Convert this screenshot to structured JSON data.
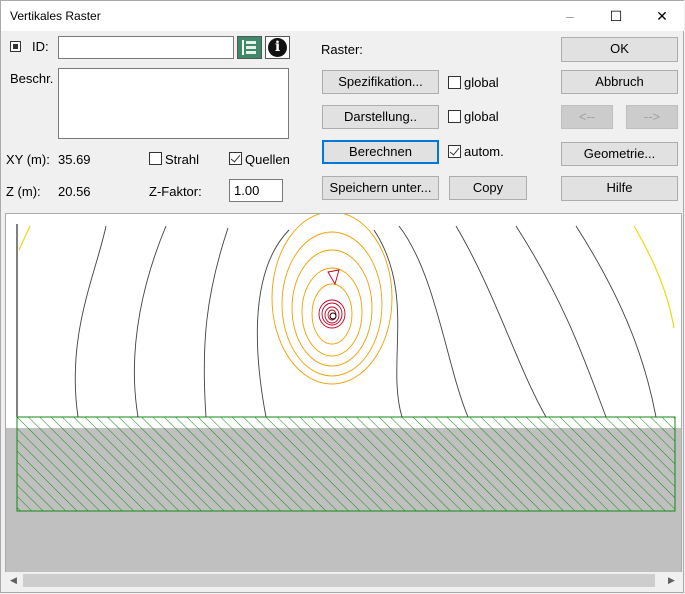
{
  "window": {
    "title": "Vertikales Raster",
    "minimize": "–",
    "maximize": "☐",
    "close": "✕"
  },
  "left": {
    "id_label": "ID:",
    "id_value": "",
    "beschr_label": "Beschr.",
    "beschr_value": "",
    "xy_label": "XY (m):",
    "xy_value": "35.69",
    "z_label": "Z (m):",
    "z_value": "20.56",
    "strahl_label": "Strahl",
    "strahl_checked": false,
    "quellen_label": "Quellen",
    "quellen_checked": true,
    "zfaktor_label": "Z-Faktor:",
    "zfaktor_value": "1.00"
  },
  "middle": {
    "raster_label": "Raster:",
    "spezifikation": "Spezifikation...",
    "darstellung": "Darstellung..",
    "berechnen": "Berechnen",
    "speichern": "Speichern unter...",
    "copy": "Copy",
    "global1_label": "global",
    "global1_checked": false,
    "global2_label": "global",
    "global2_checked": false,
    "autom_label": "autom.",
    "autom_checked": true
  },
  "right": {
    "ok": "OK",
    "abbruch": "Abbruch",
    "prev": "<--",
    "next": "-->",
    "geometrie": "Geometrie...",
    "hilfe": "Hilfe"
  },
  "colors": {
    "contour_gray": "#404040",
    "contour_orange": "#f0a000",
    "contour_red": "#c00020",
    "contour_yellow": "#e8d800",
    "hatch_green": "#108a10",
    "ground_gray": "#c0c0c0"
  },
  "scrollbar": {
    "left_arrow": "◀",
    "right_arrow": "▶"
  }
}
